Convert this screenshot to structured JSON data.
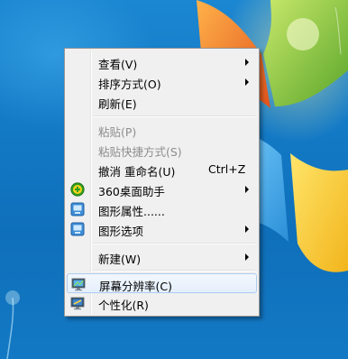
{
  "desktop": {
    "background": "#137ac6",
    "logo": "windows-7-logo"
  },
  "context_menu": {
    "items": [
      {
        "label": "查看(V)",
        "submenu": true
      },
      {
        "label": "排序方式(O)",
        "submenu": true
      },
      {
        "label": "刷新(E)"
      },
      {
        "label": "粘贴(P)",
        "disabled": true
      },
      {
        "label": "粘贴快捷方式(S)",
        "disabled": true
      },
      {
        "label": "撤消 重命名(U)",
        "shortcut": "Ctrl+Z"
      },
      {
        "label": "360桌面助手",
        "icon": "360-assistant-icon",
        "submenu": true
      },
      {
        "label": "图形属性......",
        "icon": "graphics-properties-icon"
      },
      {
        "label": "图形选项",
        "icon": "graphics-options-icon",
        "submenu": true
      },
      {
        "label": "新建(W)",
        "submenu": true
      },
      {
        "label": "屏幕分辨率(C)",
        "icon": "screen-resolution-icon",
        "highlighted": true
      },
      {
        "label": "个性化(R)",
        "icon": "personalize-icon"
      }
    ],
    "colors": {
      "background": "#f0f0f0",
      "highlight_border": "#aeccf0",
      "disabled_text": "#8d8d8d"
    }
  }
}
